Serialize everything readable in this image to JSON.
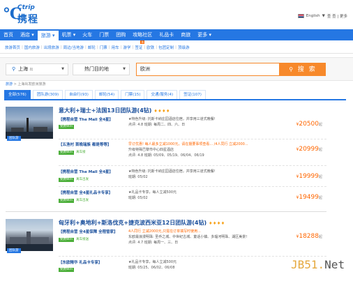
{
  "header": {
    "logo_en": "Ctrip",
    "logo_cn": "携程",
    "language": "English",
    "lang_arrow": "▼",
    "account": "查 查 | 更多"
  },
  "nav": {
    "items": [
      "首页",
      "酒店 ▾",
      "旅游 ▾",
      "机票 ▾",
      "火车",
      "门票",
      "团购",
      "攻略社区",
      "礼品卡",
      "商旅",
      "更多 ▾"
    ]
  },
  "subnav": {
    "items": [
      "旅游首页",
      "国内旅游",
      "出境旅游",
      "周边/当地游",
      "邮轮",
      "门票",
      "用车",
      "游学",
      "签证",
      "欧铁",
      "包团定制",
      "顶级游"
    ],
    "hot_tag": "热"
  },
  "search": {
    "city": "上海",
    "city_suffix": "出",
    "destination_label": "热门目的地",
    "query": "欧洲",
    "button": "搜 索"
  },
  "breadcrumb": {
    "home": "旅游",
    "path": " > 上海出发欧洲旅游"
  },
  "tabs": [
    {
      "label": "全部(576)",
      "active": true
    },
    {
      "label": "团队游(309)",
      "active": false
    },
    {
      "label": "自由行(93)",
      "active": false
    },
    {
      "label": "邮轮(54)",
      "active": false
    },
    {
      "label": "门票(15)",
      "active": false
    },
    {
      "label": "交通/服务(4)",
      "active": false
    },
    {
      "label": "签证(107)",
      "active": false
    }
  ],
  "products": [
    {
      "title": "意大利+瑞士+法国13日团队游(4钻)",
      "stars": "♦♦♦♦",
      "tag": "团队游",
      "offers": [
        {
          "name": "【携程自营 The Mall 全4星】",
          "wifi": "免费WiFi",
          "extra": "",
          "desc1": "★特色升级: 托斯卡纳庄园酒店住宿，并享用三道式晚餐!",
          "desc2": "点评: 4.8    班期: 每周二、四、六、日",
          "price": "20500"
        },
        {
          "name": "【五渔村 首晚瑞族 都是等等】",
          "wifi": "免费WiFi",
          "extra": "离车接",
          "desc1": "早订优惠! 每人最多立减1000元，请在摄要事项查看... /4人同行 立减2000...",
          "desc2": "升级特殊巴黎市中心四星酒店",
          "desc3": "点评: 4.8    班期: 05/09、05/19、06/04、06/19",
          "price": "20999"
        },
        {
          "name": "【携程自营 The Mall 全4星】",
          "wifi": "免费WiFi",
          "extra": "离车出发",
          "desc1": "★特色升级: 托斯卡纳庄园酒店住宿，并享用三道式晚餐!",
          "desc2": "班期: 05/02",
          "price": "19999"
        },
        {
          "name": "【携程自营 全4星礼品卡专享】",
          "wifi": "免费WiFi",
          "extra": "离车出发",
          "desc1": "★礼品卡专享，每人立减500元",
          "desc2": "班期: 05/02",
          "price": "19499"
        }
      ]
    },
    {
      "title": "匈牙利+奥地利+斯洛伐克+捷克波西米亚12日团队游(4钻)",
      "stars": "♦♦♦♦",
      "tag": "团队游",
      "offers": [
        {
          "name": "【携程自营 全4星保障 全程管家】",
          "wifi": "免费WiFi",
          "extra": "离车接送",
          "desc1": "4人同行 立减2000元,只需在订单填写时使用...",
          "desc2": "东欧最浪漫明珠: 圣乔之城、中世纪古城、童话小镇、多瑙河明珠、湖区美景!",
          "desc3": "点评: 4.7    班期: 每周一、三、日",
          "price": "18288"
        },
        {
          "name": "【东欧精华 礼品卡专享】",
          "wifi": "免费WiFi",
          "extra": "",
          "desc1": "★礼品卡专享，每人立减500元",
          "desc2": "班期: 05/25、06/02、06/08",
          "price": ""
        }
      ]
    }
  ],
  "price_prefix": "¥",
  "price_suffix": "起",
  "watermark": {
    "brand": "JB51.",
    "tld": "Net"
  }
}
